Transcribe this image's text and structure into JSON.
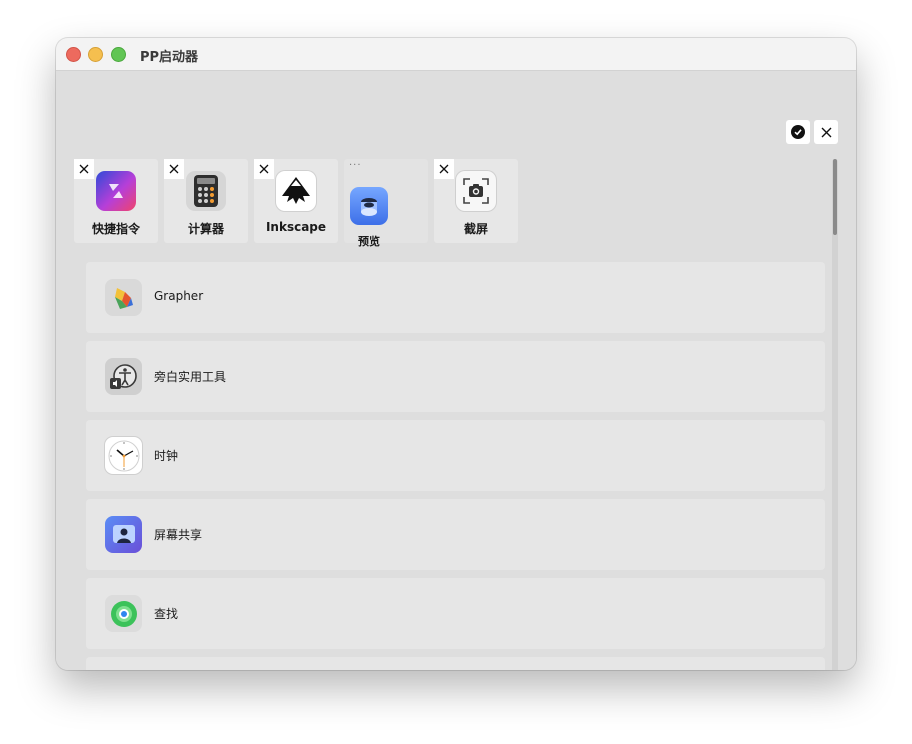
{
  "window": {
    "title": "PP启动器"
  },
  "toolbar": {
    "confirm_icon": "checkmark-circle-icon",
    "close_icon": "close-icon"
  },
  "pinned": [
    {
      "label": "快捷指令",
      "icon": "shortcuts-icon",
      "colors": [
        "#2f4ad8",
        "#c43bd8",
        "#f0446b"
      ]
    },
    {
      "label": "计算器",
      "icon": "calculator-icon",
      "colors": [
        "#3c3c3c",
        "#f39c33"
      ]
    },
    {
      "label": "Inkscape",
      "icon": "inkscape-icon",
      "colors": [
        "#000000",
        "#ffffff"
      ]
    },
    {
      "label": "预览",
      "icon": "preview-icon",
      "colors": [
        "#3d7bf0",
        "#a9c8ff"
      ]
    },
    {
      "label": "截屏",
      "icon": "screenshot-icon",
      "colors": [
        "#ffffff",
        "#333333"
      ]
    }
  ],
  "apps": [
    {
      "label": "Grapher",
      "icon": "grapher-icon"
    },
    {
      "label": "旁白实用工具",
      "icon": "voiceover-utility-icon"
    },
    {
      "label": "时钟",
      "icon": "clock-icon"
    },
    {
      "label": "屏幕共享",
      "icon": "screen-sharing-icon"
    },
    {
      "label": "查找",
      "icon": "find-my-icon"
    }
  ]
}
